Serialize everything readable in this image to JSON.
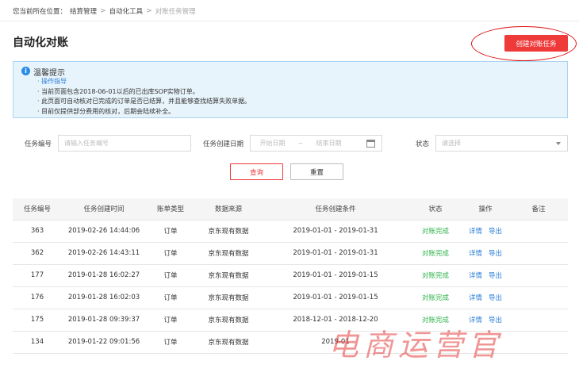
{
  "breadcrumb": {
    "prefix": "您当前所在位置：",
    "items": [
      "结算管理",
      "自动化工具"
    ],
    "current": "对账任务管理",
    "separator": ">"
  },
  "page": {
    "title": "自动化对账",
    "create_button": "创建对账任务"
  },
  "tip": {
    "icon": "i",
    "title": "温馨提示",
    "lines": [
      {
        "text": "· 操作指导",
        "link": true
      },
      {
        "text": "· 当前页面包含2018-06-01以后的已出库SOP实物订单。",
        "link": false
      },
      {
        "text": "· 此页面可自动核对已完成的订单是否已结算，并且能够查找结算失败单据。",
        "link": false
      },
      {
        "text": "· 目前仅提供部分费用的核对，后期会陆续补全。",
        "link": false
      }
    ]
  },
  "filters": {
    "task_no_label": "任务编号",
    "task_no_placeholder": "请输入任务编号",
    "date_label": "任务创建日期",
    "start_placeholder": "开始日期",
    "date_separator": "~",
    "end_placeholder": "结束日期",
    "status_label": "状态",
    "status_placeholder": "请选择",
    "query_button": "查询",
    "reset_button": "重置"
  },
  "table": {
    "headers": [
      "任务编号",
      "任务创建时间",
      "账单类型",
      "数据来源",
      "任务创建条件",
      "状态",
      "操作",
      "备注"
    ],
    "rows": [
      {
        "id": "363",
        "created": "2019-02-26 14:44:06",
        "type": "订单",
        "source": "京东现有数据",
        "condition": "2019-01-01 - 2019-01-31",
        "status": "对账完成",
        "detail": "详情",
        "export": "导出",
        "note": ""
      },
      {
        "id": "362",
        "created": "2019-02-26 14:43:11",
        "type": "订单",
        "source": "京东现有数据",
        "condition": "2019-01-01 - 2019-01-31",
        "status": "对账完成",
        "detail": "详情",
        "export": "导出",
        "note": ""
      },
      {
        "id": "177",
        "created": "2019-01-28 16:02:27",
        "type": "订单",
        "source": "京东现有数据",
        "condition": "2019-01-01 - 2019-01-15",
        "status": "对账完成",
        "detail": "详情",
        "export": "导出",
        "note": ""
      },
      {
        "id": "176",
        "created": "2019-01-28 16:02:03",
        "type": "订单",
        "source": "京东现有数据",
        "condition": "2019-01-01 - 2019-01-15",
        "status": "对账完成",
        "detail": "详情",
        "export": "导出",
        "note": ""
      },
      {
        "id": "175",
        "created": "2019-01-28 09:39:37",
        "type": "订单",
        "source": "京东现有数据",
        "condition": "2018-12-01 - 2018-12-20",
        "status": "对账完成",
        "detail": "详情",
        "export": "导出",
        "note": ""
      },
      {
        "id": "134",
        "created": "2019-01-22 09:01:56",
        "type": "订单",
        "source": "京东现有数据",
        "condition": "2019-01",
        "status": "",
        "detail": "",
        "export": "",
        "note": ""
      }
    ]
  },
  "watermark": "电商运营官",
  "colors": {
    "primary_red": "#ef3a3a",
    "success_green": "#2fb34a",
    "link_blue": "#2b7fd8",
    "tip_bg": "#e8f4fc"
  }
}
